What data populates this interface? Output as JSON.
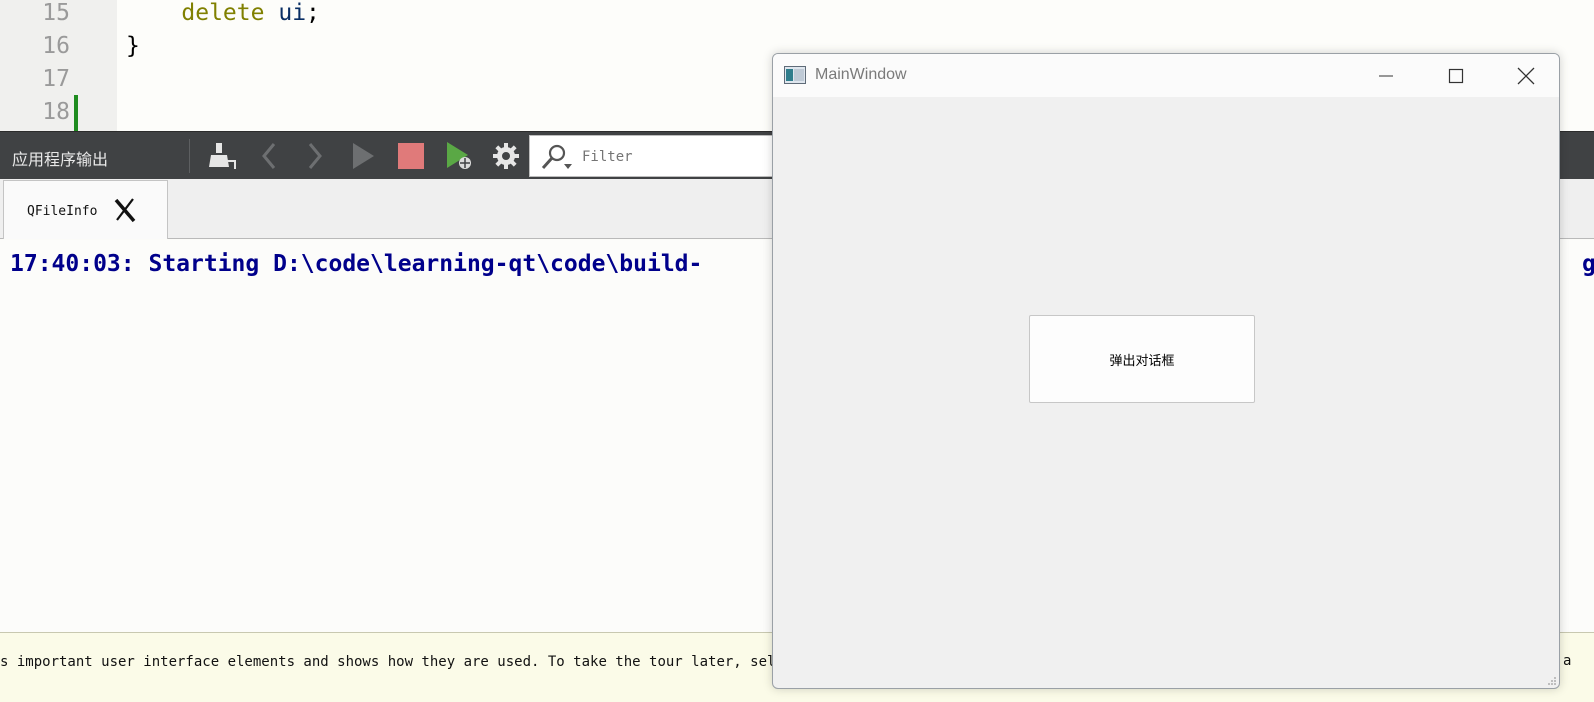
{
  "editor": {
    "lines": [
      {
        "num": "15",
        "indent": "    ",
        "keyword": "delete",
        "rest": " ",
        "ident": "ui",
        "end": ";"
      },
      {
        "num": "16",
        "text": "}"
      },
      {
        "num": "17",
        "text": ""
      },
      {
        "num": "18",
        "text": ""
      }
    ]
  },
  "toolbar": {
    "pane_title": "应用程序输出",
    "filter_placeholder": "Filter",
    "icons": [
      "clean-brush-icon",
      "prev-arrow-icon",
      "next-arrow-icon",
      "run-icon",
      "stop-icon",
      "debug-run-icon",
      "settings-gear-icon",
      "search-filter-icon"
    ]
  },
  "output": {
    "tab_label": "QFileInfo",
    "line": "17:40:03: Starting D:\\code\\learning-qt\\code\\build-",
    "line_tail": "g"
  },
  "tourbar": {
    "text": "s important user interface elements and shows how they are used. To take the tour later, select He",
    "tail": "a"
  },
  "mainwindow": {
    "title": "MainWindow",
    "button_label": "弹出对话框"
  },
  "colors": {
    "toolbar_bg": "#404244",
    "output_text": "#00008b",
    "keyword": "#808000",
    "stop_red": "#e07a7a",
    "run_green": "#5aa845"
  }
}
